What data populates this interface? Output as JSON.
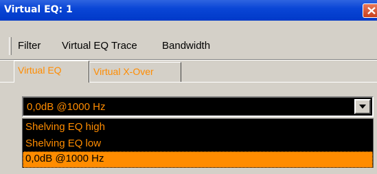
{
  "window": {
    "title": "Virtual EQ: 1"
  },
  "menu": {
    "items": [
      "Filter",
      "Virtual EQ Trace",
      "Bandwidth"
    ]
  },
  "tabs": [
    {
      "label": "Virtual EQ",
      "active": true
    },
    {
      "label": "Virtual X-Over",
      "active": false
    }
  ],
  "eq_select": {
    "value": "0,0dB @1000 Hz",
    "options": [
      {
        "label": "Shelving EQ high",
        "selected": false
      },
      {
        "label": "Shelving EQ low",
        "selected": false
      },
      {
        "label": "0,0dB @1000 Hz",
        "selected": true
      }
    ]
  },
  "colors": {
    "accent": "#ff8c00",
    "list_background": "#000000",
    "title_bar": "#0a46d6",
    "face": "#d4d0c8"
  },
  "icons": {
    "close": "close-icon",
    "dropdown": "chevron-down-icon"
  }
}
